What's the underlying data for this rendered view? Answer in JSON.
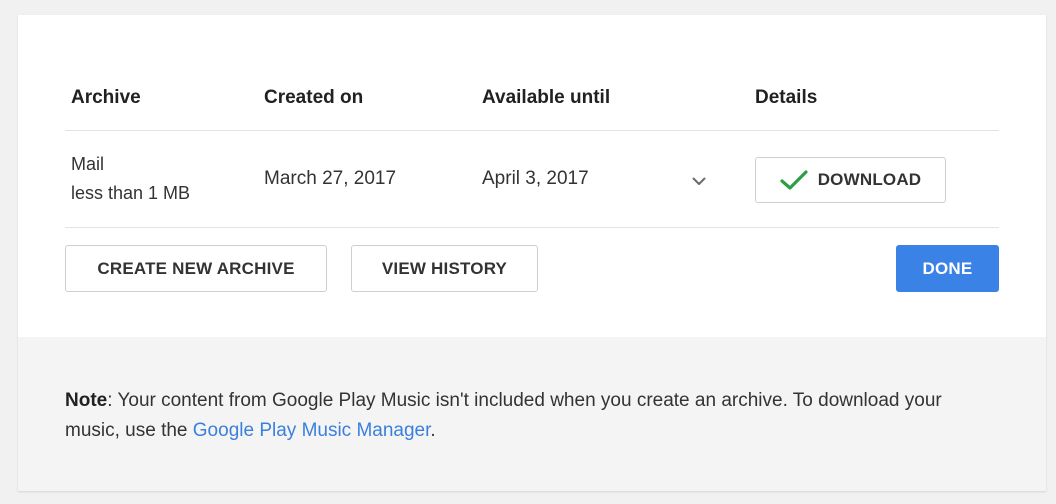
{
  "table": {
    "headers": {
      "archive": "Archive",
      "created": "Created on",
      "available": "Available until",
      "details": "Details"
    },
    "row": {
      "name": "Mail",
      "size": "less than 1 MB",
      "created": "March 27, 2017",
      "available": "April 3, 2017",
      "download_label": "DOWNLOAD"
    }
  },
  "actions": {
    "create_label": "CREATE NEW ARCHIVE",
    "history_label": "VIEW HISTORY",
    "done_label": "DONE"
  },
  "note": {
    "bold": "Note",
    "text_before": ": Your content from Google Play Music isn't included when you create an archive. To download your music, use the ",
    "link": "Google Play Music Manager",
    "text_after": "."
  },
  "colors": {
    "accent": "#3b82e6",
    "check": "#2e9e44",
    "link": "#3b7fdd"
  },
  "icons": {
    "expand": "chevron-down-icon",
    "status": "check-icon"
  }
}
